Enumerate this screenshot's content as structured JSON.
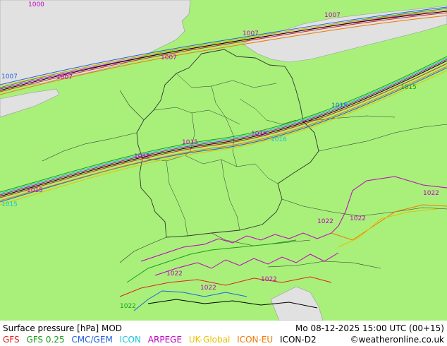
{
  "title": "Surface pressure [hPa] MOD",
  "valid_time": "Mo 08-12-2025 15:00 UTC (00+15)",
  "credit": "©weatheronline.co.uk",
  "colors": {
    "land": "#a8f07a",
    "sea": "#e1e1e1",
    "gfs": "#e0221e",
    "gfs025": "#18a018",
    "cmc": "#2060e0",
    "icon": "#18c4dc",
    "arpege": "#c000c0",
    "ukglobal": "#e8c000",
    "iconeu": "#f07800",
    "icond2": "#000000"
  },
  "models": [
    {
      "name": "GFS",
      "color": "#e0221e"
    },
    {
      "name": "GFS 0.25",
      "color": "#18a018"
    },
    {
      "name": "CMC/GEM",
      "color": "#2060e0"
    },
    {
      "name": "ICON",
      "color": "#18c4dc"
    },
    {
      "name": "ARPEGE",
      "color": "#c000c0"
    },
    {
      "name": "UK-Global",
      "color": "#e8c000"
    },
    {
      "name": "ICON-EU",
      "color": "#f07800"
    },
    {
      "name": "ICON-D2",
      "color": "#000000"
    }
  ],
  "isobar_labels": [
    "1000",
    "1007",
    "1015",
    "1022",
    "1018",
    "1016"
  ]
}
